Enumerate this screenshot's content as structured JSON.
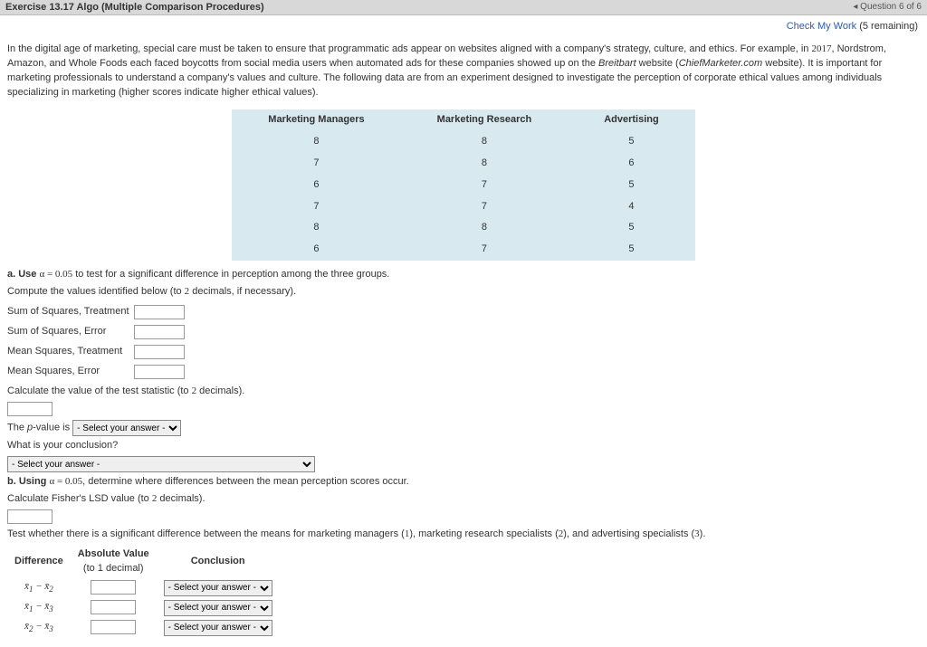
{
  "topbar": {
    "left": "Exercise 13.17 Algo (Multiple Comparison Procedures)",
    "right": "Question 6 of 6"
  },
  "linkbar": {
    "check_link": "Check My Work",
    "remaining": "(5 remaining)"
  },
  "paragraph": {
    "p1a": "In the digital age of marketing, special care must be taken to ensure that programmatic ads appear on websites aligned with a company's strategy, culture, and ethics. For example, in ",
    "year": "2017",
    "p1b": ", Nordstrom, Amazon, and Whole Foods each faced boycotts from social media users when automated ads for these companies showed up on the ",
    "site1": "Breitbart",
    "p1c": " website (",
    "site2": "ChiefMarketer.com",
    "p1d": " website). It is important for marketing professionals to understand a company's values and culture. The following data are from an experiment designed to investigate the perception of corporate ethical values among individuals specializing in marketing (higher scores indicate higher ethical values)."
  },
  "table": {
    "headers": [
      "Marketing Managers",
      "Marketing Research",
      "Advertising"
    ],
    "rows": [
      [
        8,
        8,
        5
      ],
      [
        7,
        8,
        6
      ],
      [
        6,
        7,
        5
      ],
      [
        7,
        7,
        4
      ],
      [
        8,
        8,
        5
      ],
      [
        6,
        7,
        5
      ]
    ]
  },
  "a": {
    "line1a": "a. Use ",
    "alpha": "α = 0.05",
    "line1b": " to test for a significant difference in perception among the three groups.",
    "compute_a": "Compute the values identified below (to ",
    "two": "2",
    "compute_b": " decimals, if necessary)."
  },
  "fields": {
    "sst": "Sum of Squares, Treatment",
    "sse": "Sum of Squares, Error",
    "mst": "Mean Squares, Treatment",
    "mse": "Mean Squares, Error"
  },
  "tstat_a": "Calculate the value of the test statistic (to ",
  "tstat_b": " decimals).",
  "pval_a": "The ",
  "pval_p": "p",
  "pval_b": "-value is",
  "select_placeholder": "- Select your answer -",
  "conclusion_q": "What is your conclusion?",
  "b": {
    "line1a": "b. Using ",
    "alpha": "α = 0.05",
    "line1b": ", determine where differences between the mean perception scores occur.",
    "lsd_a": "Calculate Fisher's LSD value (to ",
    "lsd_b": " decimals).",
    "test_a": "Test whether there is a significant difference between the means for marketing managers (",
    "one": "1",
    "test_b": "), marketing research specialists (",
    "twoN": "2",
    "test_c": "), and advertising specialists (",
    "three": "3",
    "test_d": ")."
  },
  "lsd_table": {
    "h1": "Difference",
    "h2a": "Absolute Value",
    "h2b": "(to 1 decimal)",
    "h3": "Conclusion",
    "rows": [
      {
        "d": "x̄1 − x̄2"
      },
      {
        "d": "x̄1 − x̄3"
      },
      {
        "d": "x̄2 − x̄3"
      }
    ]
  },
  "chart_data": {
    "type": "table",
    "categories": [
      "Marketing Managers",
      "Marketing Research",
      "Advertising"
    ],
    "series": [
      {
        "name": "Marketing Managers",
        "values": [
          8,
          7,
          6,
          7,
          8,
          6
        ]
      },
      {
        "name": "Marketing Research",
        "values": [
          8,
          8,
          7,
          7,
          8,
          7
        ]
      },
      {
        "name": "Advertising",
        "values": [
          5,
          6,
          5,
          4,
          5,
          5
        ]
      }
    ]
  }
}
